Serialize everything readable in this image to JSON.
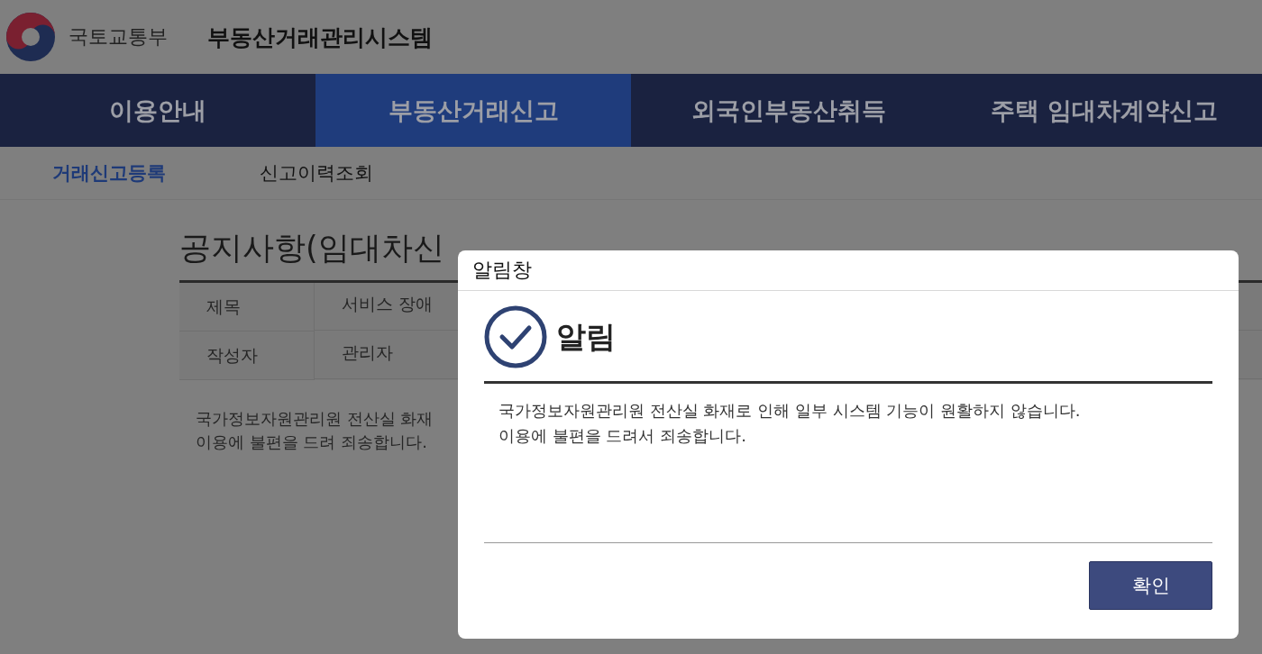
{
  "header": {
    "ministry": "국토교통부",
    "system": "부동산거래관리시스템"
  },
  "nav": [
    {
      "label": "이용안내",
      "selected": false
    },
    {
      "label": "부동산거래신고",
      "selected": true
    },
    {
      "label": "외국인부동산취득",
      "selected": false
    },
    {
      "label": "주택 임대차계약신고",
      "selected": false
    }
  ],
  "subnav": [
    {
      "label": "거래신고등록",
      "selected": true
    },
    {
      "label": "신고이력조회",
      "selected": false
    }
  ],
  "notice": {
    "title": "공지사항(임대차신",
    "rows": [
      {
        "label": "제목",
        "value": "서비스 장애"
      },
      {
        "label": "작성자",
        "value": "관리자"
      }
    ],
    "body": [
      "국가정보자원관리원 전산실 화재",
      "이용에 불편을 드려 죄송합니다."
    ]
  },
  "dialog": {
    "title": "알림창",
    "heading": "알림",
    "message": [
      "국가정보자원관리원 전산실 화재로 인해 일부 시스템 기능이 원활하지 않습니다.",
      "이용에 불편을 드려서 죄송합니다."
    ],
    "button": "확인"
  }
}
